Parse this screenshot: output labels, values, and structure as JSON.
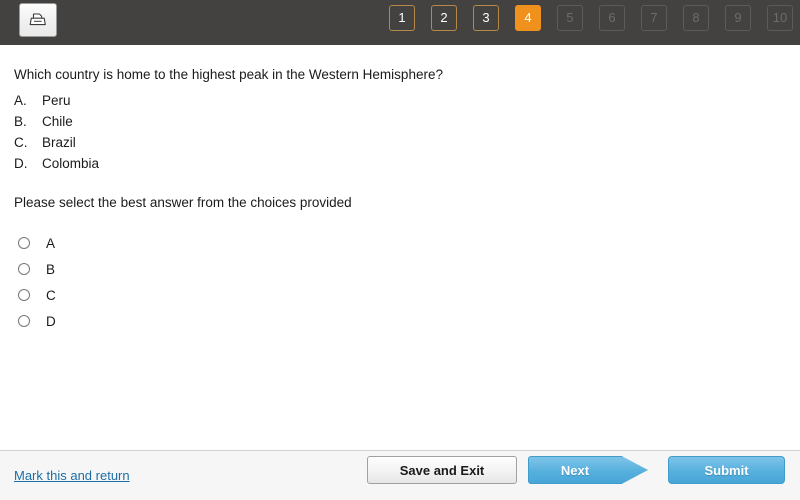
{
  "header": {
    "print_button": {
      "icon": "printer-icon",
      "title": "Print"
    },
    "pager": {
      "items": [
        {
          "label": "1",
          "state": "done"
        },
        {
          "label": "2",
          "state": "done"
        },
        {
          "label": "3",
          "state": "done"
        },
        {
          "label": "4",
          "state": "active"
        },
        {
          "label": "5",
          "state": "locked"
        },
        {
          "label": "6",
          "state": "locked"
        },
        {
          "label": "7",
          "state": "locked"
        },
        {
          "label": "8",
          "state": "locked"
        },
        {
          "label": "9",
          "state": "locked"
        },
        {
          "label": "10",
          "state": "locked"
        }
      ]
    },
    "background_color": "#444241",
    "active_color": "#f0911e",
    "done_border_color": "#b5884a",
    "locked_border_color": "#5d5a58"
  },
  "main": {
    "question": "Which country is home to the highest peak in the Western Hemisphere?",
    "stem_options": [
      {
        "letter": "A.",
        "text": "Peru"
      },
      {
        "letter": "B.",
        "text": "Chile"
      },
      {
        "letter": "C.",
        "text": "Brazil"
      },
      {
        "letter": "D.",
        "text": "Colombia"
      }
    ],
    "instruction": "Please select the best answer from the choices provided",
    "choices": [
      {
        "label": "A",
        "selected": false
      },
      {
        "label": "B",
        "selected": false
      },
      {
        "label": "C",
        "selected": false
      },
      {
        "label": "D",
        "selected": false
      }
    ]
  },
  "footer": {
    "mark_link": "Mark this and return",
    "mark_link_color": "#1c6ea4",
    "save_label": "Save and Exit",
    "next_label": "Next",
    "submit_label": "Submit",
    "button_blue": "#57b0de"
  }
}
